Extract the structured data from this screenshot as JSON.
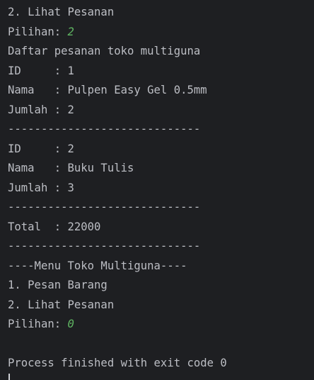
{
  "console": {
    "lines": [
      {
        "text": "2. Lihat Pesanan",
        "input": ""
      },
      {
        "text": "Pilihan: ",
        "input": "2"
      },
      {
        "text": "Daftar pesanan toko multiguna",
        "input": ""
      },
      {
        "text": "ID     : 1",
        "input": ""
      },
      {
        "text": "Nama   : Pulpen Easy Gel 0.5mm",
        "input": ""
      },
      {
        "text": "Jumlah : 2",
        "input": ""
      },
      {
        "text": "-----------------------------",
        "input": ""
      },
      {
        "text": "ID     : 2",
        "input": ""
      },
      {
        "text": "Nama   : Buku Tulis",
        "input": ""
      },
      {
        "text": "Jumlah : 3",
        "input": ""
      },
      {
        "text": "-----------------------------",
        "input": ""
      },
      {
        "text": "Total  : 22000",
        "input": ""
      },
      {
        "text": "-----------------------------",
        "input": ""
      },
      {
        "text": "----Menu Toko Multiguna----",
        "input": ""
      },
      {
        "text": "1. Pesan Barang",
        "input": ""
      },
      {
        "text": "2. Lihat Pesanan",
        "input": ""
      },
      {
        "text": "Pilihan: ",
        "input": "0"
      },
      {
        "text": "",
        "input": ""
      },
      {
        "text": "Process finished with exit code 0",
        "input": ""
      }
    ]
  },
  "colors": {
    "background": "#1e1f22",
    "text": "#bcbec4",
    "user_input": "#5fb562"
  }
}
